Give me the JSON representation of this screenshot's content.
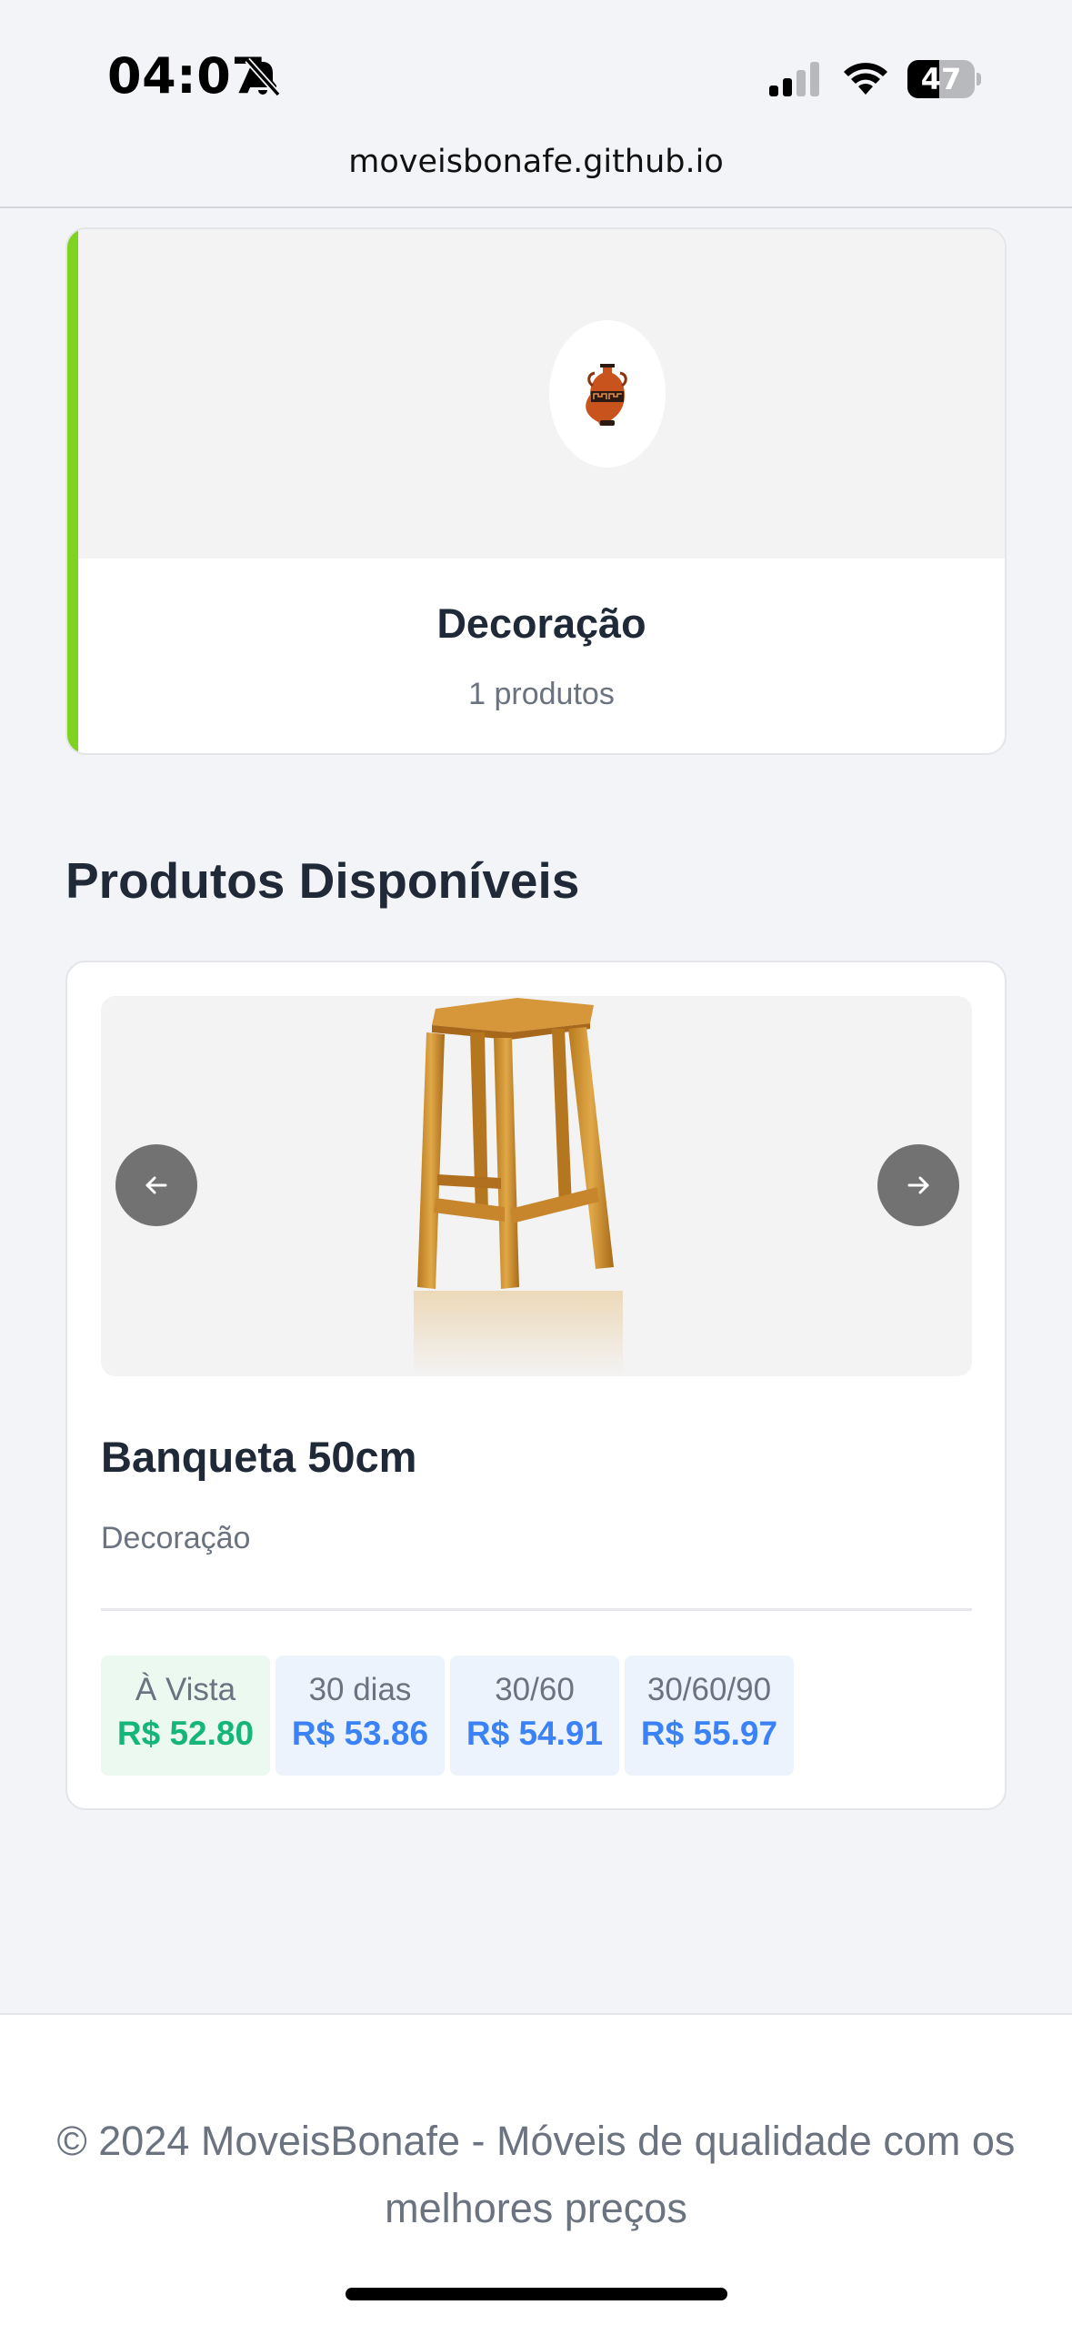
{
  "status_bar": {
    "time": "04:07",
    "battery": "47",
    "battery_level": 0.47
  },
  "browser": {
    "url": "moveisbonafe.github.io"
  },
  "category": {
    "icon": "amphora-vase-icon",
    "title": "Decoração",
    "count": "1 produtos",
    "accent_color": "#7dd320"
  },
  "section": {
    "title": "Produtos Disponíveis"
  },
  "product": {
    "image": "wooden-stool",
    "title": "Banqueta 50cm",
    "category": "Decoração",
    "prices": [
      {
        "label": "À Vista",
        "value": "R$ 52.80"
      },
      {
        "label": "30 dias",
        "value": "R$ 53.86"
      },
      {
        "label": "30/60",
        "value": "R$ 54.91"
      },
      {
        "label": "30/60/90",
        "value": "R$ 55.97"
      }
    ],
    "cash_color": "#16b67a",
    "term_color": "#3b82f6"
  },
  "footer": {
    "text": "© 2024 MoveisBonafe - Móveis de qualidade com os melhores preços"
  }
}
